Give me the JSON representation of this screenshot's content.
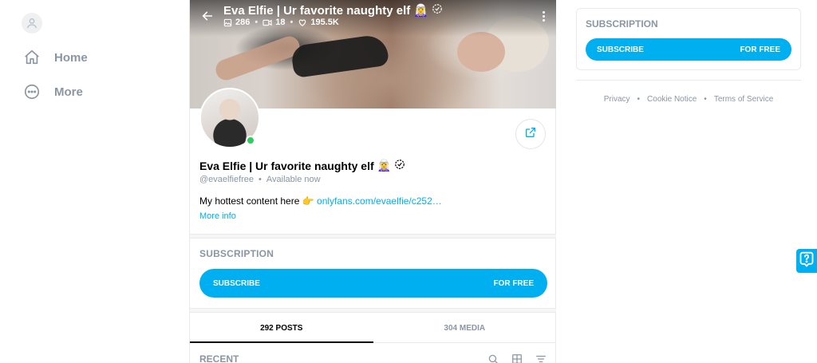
{
  "nav": {
    "items": [
      {
        "label": "Home",
        "icon": "home-icon"
      },
      {
        "label": "More",
        "icon": "more-circle-icon"
      }
    ]
  },
  "profile": {
    "display_name": "Eva Elfie | Ur favorite naughty elf",
    "emoji": "🧝‍♀️",
    "handle": "@evaelfiefree",
    "separator": "•",
    "status": "Available now",
    "stats": {
      "photos": "286",
      "videos": "18",
      "likes": "195.5K"
    },
    "bio_text": "My hottest content here 👉 ",
    "bio_link": "onlyfans.com/evaelfie/c252…",
    "more_info": "More info"
  },
  "subscription": {
    "title": "SUBSCRIPTION",
    "button_label": "SUBSCRIBE",
    "button_price": "FOR FREE"
  },
  "tabs": [
    {
      "label": "292 POSTS",
      "active": true
    },
    {
      "label": "304 MEDIA",
      "active": false
    }
  ],
  "recent": {
    "label": "RECENT"
  },
  "sidebar_card": {
    "title": "SUBSCRIPTION",
    "button_label": "SUBSCRIBE",
    "button_price": "FOR FREE"
  },
  "footer": {
    "links": [
      "Privacy",
      "Cookie Notice",
      "Terms of Service"
    ],
    "separator": "•"
  },
  "colors": {
    "accent": "#00aff0",
    "muted": "#8a96a3",
    "online": "#2fcc5f"
  }
}
